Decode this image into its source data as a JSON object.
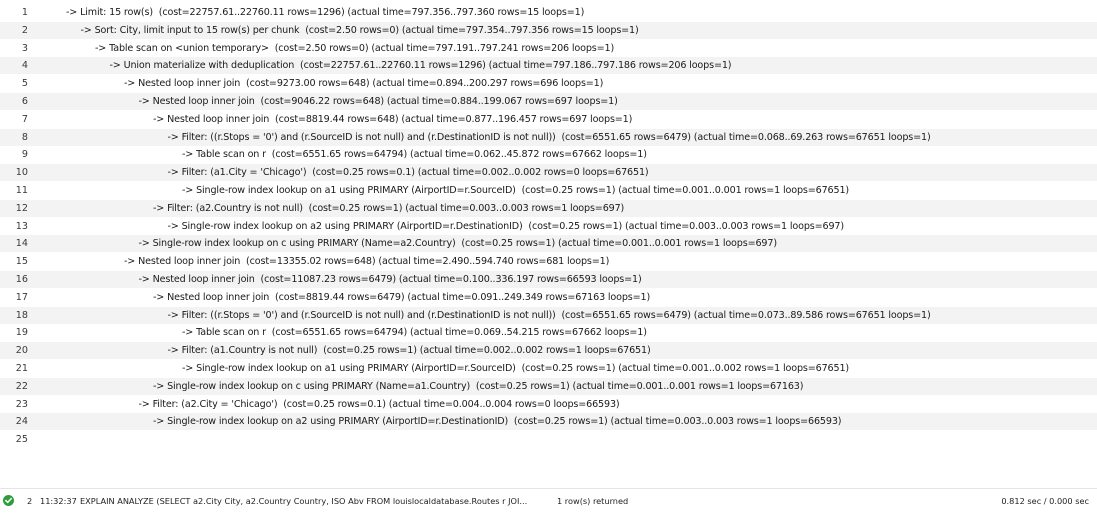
{
  "editor": {
    "lines": [
      {
        "n": "1",
        "indent": 0,
        "text": "-> Limit: 15 row(s)  (cost=22757.61..22760.11 rows=1296) (actual time=797.356..797.360 rows=15 loops=1)"
      },
      {
        "n": "2",
        "indent": 1,
        "text": "-> Sort: City, limit input to 15 row(s) per chunk  (cost=2.50 rows=0) (actual time=797.354..797.356 rows=15 loops=1)"
      },
      {
        "n": "3",
        "indent": 2,
        "text": "-> Table scan on <union temporary>  (cost=2.50 rows=0) (actual time=797.191..797.241 rows=206 loops=1)"
      },
      {
        "n": "4",
        "indent": 3,
        "text": "-> Union materialize with deduplication  (cost=22757.61..22760.11 rows=1296) (actual time=797.186..797.186 rows=206 loops=1)"
      },
      {
        "n": "5",
        "indent": 4,
        "text": "-> Nested loop inner join  (cost=9273.00 rows=648) (actual time=0.894..200.297 rows=696 loops=1)"
      },
      {
        "n": "6",
        "indent": 5,
        "text": "-> Nested loop inner join  (cost=9046.22 rows=648) (actual time=0.884..199.067 rows=697 loops=1)"
      },
      {
        "n": "7",
        "indent": 6,
        "text": "-> Nested loop inner join  (cost=8819.44 rows=648) (actual time=0.877..196.457 rows=697 loops=1)"
      },
      {
        "n": "8",
        "indent": 7,
        "text": "-> Filter: ((r.Stops = '0') and (r.SourceID is not null) and (r.DestinationID is not null))  (cost=6551.65 rows=6479) (actual time=0.068..69.263 rows=67651 loops=1)"
      },
      {
        "n": "9",
        "indent": 8,
        "text": "-> Table scan on r  (cost=6551.65 rows=64794) (actual time=0.062..45.872 rows=67662 loops=1)"
      },
      {
        "n": "10",
        "indent": 7,
        "text": "-> Filter: (a1.City = 'Chicago')  (cost=0.25 rows=0.1) (actual time=0.002..0.002 rows=0 loops=67651)"
      },
      {
        "n": "11",
        "indent": 8,
        "text": "-> Single-row index lookup on a1 using PRIMARY (AirportID=r.SourceID)  (cost=0.25 rows=1) (actual time=0.001..0.001 rows=1 loops=67651)"
      },
      {
        "n": "12",
        "indent": 6,
        "text": "-> Filter: (a2.Country is not null)  (cost=0.25 rows=1) (actual time=0.003..0.003 rows=1 loops=697)"
      },
      {
        "n": "13",
        "indent": 7,
        "text": "-> Single-row index lookup on a2 using PRIMARY (AirportID=r.DestinationID)  (cost=0.25 rows=1) (actual time=0.003..0.003 rows=1 loops=697)"
      },
      {
        "n": "14",
        "indent": 5,
        "text": "-> Single-row index lookup on c using PRIMARY (Name=a2.Country)  (cost=0.25 rows=1) (actual time=0.001..0.001 rows=1 loops=697)"
      },
      {
        "n": "15",
        "indent": 4,
        "text": "-> Nested loop inner join  (cost=13355.02 rows=648) (actual time=2.490..594.740 rows=681 loops=1)"
      },
      {
        "n": "16",
        "indent": 5,
        "text": "-> Nested loop inner join  (cost=11087.23 rows=6479) (actual time=0.100..336.197 rows=66593 loops=1)"
      },
      {
        "n": "17",
        "indent": 6,
        "text": "-> Nested loop inner join  (cost=8819.44 rows=6479) (actual time=0.091..249.349 rows=67163 loops=1)"
      },
      {
        "n": "18",
        "indent": 7,
        "text": "-> Filter: ((r.Stops = '0') and (r.SourceID is not null) and (r.DestinationID is not null))  (cost=6551.65 rows=6479) (actual time=0.073..89.586 rows=67651 loops=1)"
      },
      {
        "n": "19",
        "indent": 8,
        "text": "-> Table scan on r  (cost=6551.65 rows=64794) (actual time=0.069..54.215 rows=67662 loops=1)"
      },
      {
        "n": "20",
        "indent": 7,
        "text": "-> Filter: (a1.Country is not null)  (cost=0.25 rows=1) (actual time=0.002..0.002 rows=1 loops=67651)"
      },
      {
        "n": "21",
        "indent": 8,
        "text": "-> Single-row index lookup on a1 using PRIMARY (AirportID=r.SourceID)  (cost=0.25 rows=1) (actual time=0.001..0.002 rows=1 loops=67651)"
      },
      {
        "n": "22",
        "indent": 6,
        "text": "-> Single-row index lookup on c using PRIMARY (Name=a1.Country)  (cost=0.25 rows=1) (actual time=0.001..0.001 rows=1 loops=67163)"
      },
      {
        "n": "23",
        "indent": 5,
        "text": "-> Filter: (a2.City = 'Chicago')  (cost=0.25 rows=0.1) (actual time=0.004..0.004 rows=0 loops=66593)"
      },
      {
        "n": "24",
        "indent": 6,
        "text": "-> Single-row index lookup on a2 using PRIMARY (AirportID=r.DestinationID)  (cost=0.25 rows=1) (actual time=0.003..0.003 rows=1 loops=66593)"
      },
      {
        "n": "25",
        "indent": 0,
        "text": ""
      }
    ]
  },
  "output": {
    "status_icon": "success-check-icon",
    "status_color": "#2f9d3b",
    "number": "2",
    "time": "11:32:37",
    "action": "EXPLAIN ANALYZE (SELECT a2.City City, a2.Country Country, ISO Abv FROM louislocaldatabase.Routes r JOI...",
    "message": "1 row(s) returned",
    "duration": "0.812 sec / 0.000 sec"
  }
}
